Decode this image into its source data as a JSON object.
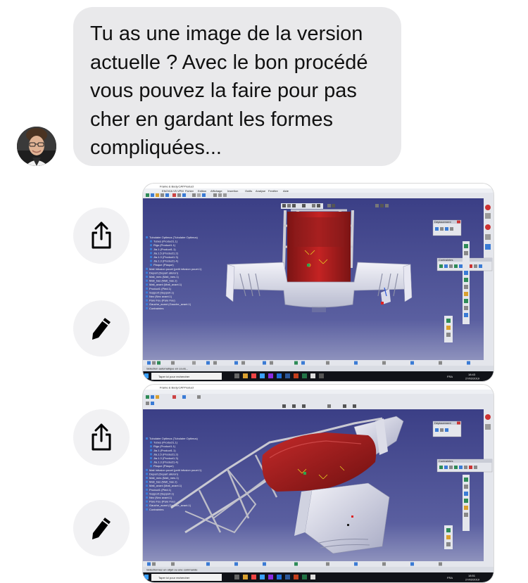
{
  "message": {
    "text_lines": [
      "Tu as une image de la version",
      "actuelle ? Avec le bon procédé",
      "vous pouvez la faire pour pas",
      "cher en gardant les formes",
      "compliquées..."
    ],
    "bubble_color": "#e9e9eb"
  },
  "actions": {
    "share_icon": "share-icon",
    "edit_icon": "pencil-icon"
  },
  "screenshot_1": {
    "title": "Frame & Body.CATProduct",
    "menu": [
      "ENOVIA V5 VPM",
      "Fichier",
      "Edition",
      "Affichage",
      "Insertion",
      "Outils",
      "Analyse",
      "Fenêtre",
      "Aide"
    ],
    "tree": [
      "Tubulaire Optimus (Tubulaire Optimus)",
      "Tubes (Product1.1)",
      "Rigs (Product1.1)",
      "Jia.1 (Product1.1)",
      "Jia.1.5 (Product1.2)",
      "Jia.1.3 (Product1.3)",
      "Jia.1.3 (Product1.4)",
      "Plaque (Plaque)",
      "Mati Infusion pouet (petit infusion pouet.1)",
      "Depart (Depart aileron)",
      "Mati_mes (Mati_mes.1)",
      "Mati_bas (Mati_bas.1)",
      "Mati_avant (Mati_avant.1)",
      "Product1 (Pied.1)",
      "Support (Support.1)",
      "Nez (Nez avant.1)",
      "Pare Fou (Pare Fou)",
      "Gauche_avant (Gauche_avant.1)",
      "Contraintes"
    ],
    "panel_deplacement": "Déplacement",
    "panel_contraintes": "Contraintes",
    "status": "Sélection automatique en cours...",
    "search": "Taper ici pour rechercher",
    "lang": "FRA",
    "time": "18:43",
    "date": "27/02/2019"
  },
  "screenshot_2": {
    "title": "Frame & Body.CATProduct",
    "panel_deplacement": "Déplacement",
    "panel_contraintes": "Contraintes",
    "status": "Sélectionnez un objet ou une commande",
    "search": "Taper ici pour rechercher",
    "lang": "FRA",
    "time": "18:51",
    "date": "27/02/2019"
  }
}
